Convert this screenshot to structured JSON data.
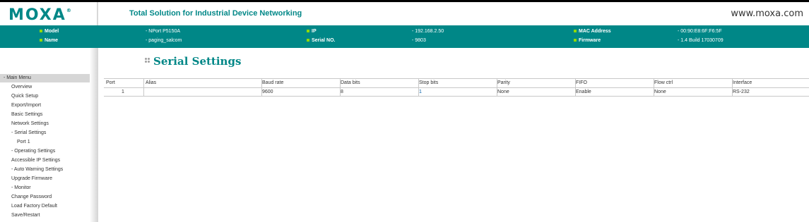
{
  "header": {
    "logo": "MOXA",
    "logo_mark": "®",
    "tagline": "Total Solution for Industrial Device Networking",
    "site": "www.moxa.com"
  },
  "info": {
    "model_label": "Model",
    "model_value": "- NPort P5150A",
    "name_label": "Name",
    "name_value": "- paging_salcom",
    "ip_label": "IP",
    "ip_value": "- 192.168.2.50",
    "serial_label": "Serial NO.",
    "serial_value": "- 9803",
    "mac_label": "MAC Address",
    "mac_value": "- 00:90:E8:6F:F6:5F",
    "firmware_label": "Firmware",
    "firmware_value": "- 1.4 Build 17030709"
  },
  "sidebar": {
    "header": "- Main Menu",
    "items": [
      "Overview",
      "Quick Setup",
      "Export/Import",
      "Basic Settings",
      "Network Settings",
      "- Serial Settings",
      "Port 1",
      "- Operating Settings",
      "Accessible IP Settings",
      "- Auto Warning Settings",
      "Upgrade Firmware",
      "- Monitor",
      "Change Password",
      "Load Factory Default",
      "Save/Restart"
    ]
  },
  "main": {
    "title": "Serial Settings",
    "columns": [
      "Port",
      "Alias",
      "Baud rate",
      "Data bits",
      "Stop bits",
      "Parity",
      "FIFO",
      "Flow ctrl",
      "Interface"
    ],
    "row": [
      "1",
      "",
      "9600",
      "8",
      "1",
      "None",
      "Enable",
      "None",
      "RS-232"
    ]
  },
  "colors": {
    "accent": "#008787",
    "bullet": "#8fd900",
    "menu_header_bg": "#d6d6d6"
  }
}
